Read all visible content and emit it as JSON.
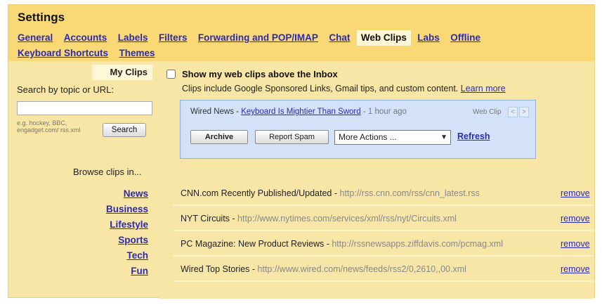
{
  "title": "Settings",
  "tabs": {
    "general": "General",
    "accounts": "Accounts",
    "labels": "Labels",
    "filters": "Filters",
    "forwarding": "Forwarding and POP/IMAP",
    "chat": "Chat",
    "webclips": "Web Clips",
    "labs": "Labs",
    "offline": "Offline",
    "shortcuts": "Keyboard Shortcuts",
    "themes": "Themes"
  },
  "sidebar": {
    "tab_label": "My Clips",
    "search_label": "Search by topic or URL:",
    "search_value": "",
    "hint": "e.g. hockey, BBC, engadget.com/ rss.xml",
    "search_button": "Search",
    "browse_label": "Browse clips in...",
    "categories": [
      "News",
      "Business",
      "Lifestyle",
      "Sports",
      "Tech",
      "Fun"
    ]
  },
  "main": {
    "checkbox_label": "Show my web clips above the Inbox",
    "checked": false,
    "description": "Clips include Google Sponsored Links, Gmail tips, and custom content.",
    "learn_more": "Learn more",
    "preview": {
      "source": "Wired News - ",
      "headline": "Keyboard Is Mightier Than Sword",
      "time": " - 1 hour ago",
      "tag": "Web Clip",
      "prev_arrow": "<",
      "next_arrow": ">",
      "archive": "Archive",
      "report_spam": "Report Spam",
      "more_actions": "More Actions ...",
      "refresh": "Refresh"
    },
    "clips": [
      {
        "name": "CNN.com Recently Published/Updated",
        "url": "http://rss.cnn.com/rss/cnn_latest.rss",
        "remove": "remove"
      },
      {
        "name": "NYT Circuits",
        "url": "http://www.nytimes.com/services/xml/rss/nyt/Circuits.xml",
        "remove": "remove"
      },
      {
        "name": "PC Magazine: New Product Reviews",
        "url": "http://rssnewsapps.ziffdavis.com/pcmag.xml",
        "remove": "remove"
      },
      {
        "name": "Wired Top Stories",
        "url": "http://www.wired.com/news/feeds/rss2/0,2610,,00.xml",
        "remove": "remove"
      }
    ]
  },
  "colors": {
    "header_bg": "#f9d975",
    "panel_bg": "#f8e6a6",
    "link": "#2a2ab5",
    "preview_bg": "#d3e2f8"
  }
}
